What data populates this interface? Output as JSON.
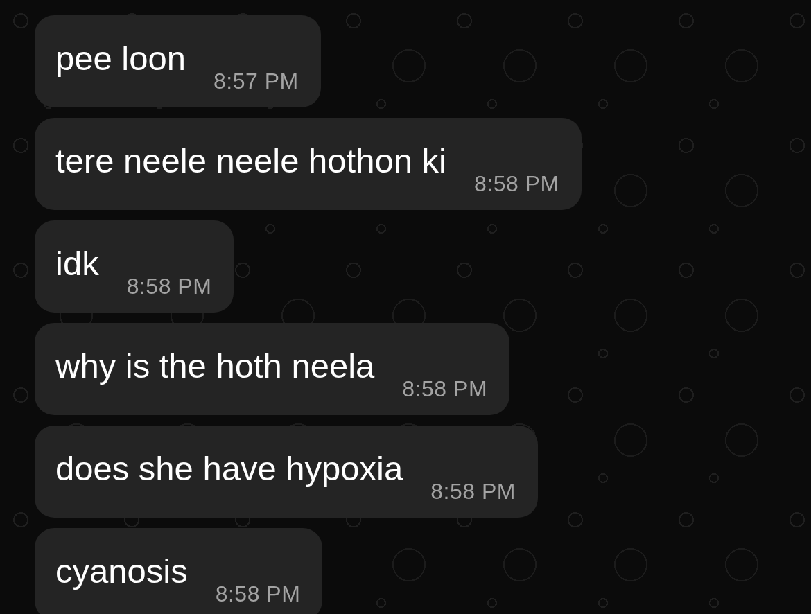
{
  "messages": [
    {
      "text": "pee loon",
      "time": "8:57 PM"
    },
    {
      "text": "tere neele neele hothon ki",
      "time": "8:58 PM"
    },
    {
      "text": "idk",
      "time": "8:58 PM"
    },
    {
      "text": "why is the hoth neela",
      "time": "8:58 PM"
    },
    {
      "text": "does she have hypoxia",
      "time": "8:58 PM"
    },
    {
      "text": "cyanosis",
      "time": "8:58 PM"
    }
  ]
}
